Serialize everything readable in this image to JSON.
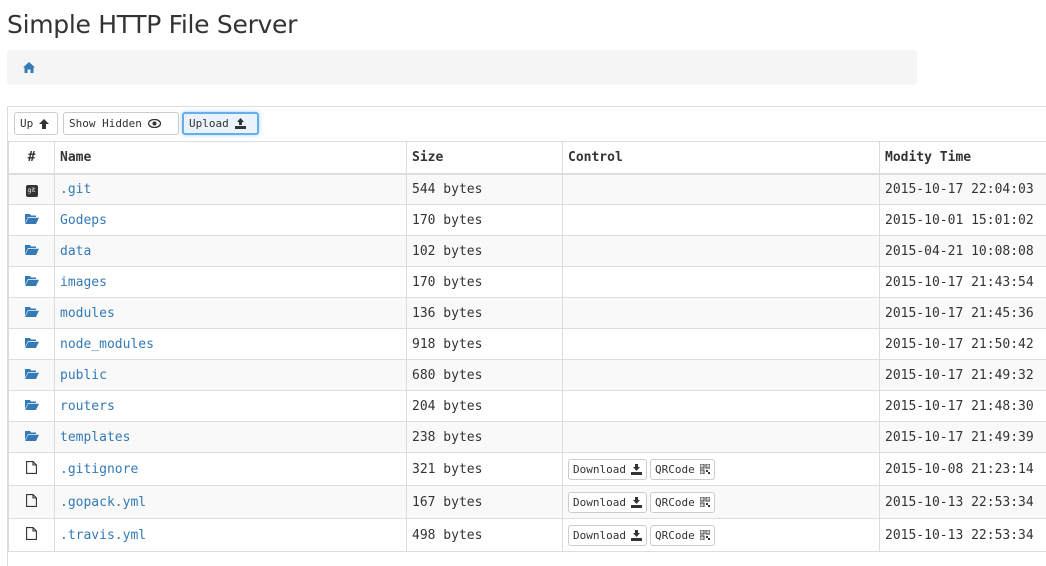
{
  "page": {
    "title": "Simple HTTP File Server"
  },
  "toolbar": {
    "up": "Up",
    "show_hidden": "Show Hidden",
    "upload": "Upload"
  },
  "table": {
    "headers": {
      "index": "#",
      "name": "Name",
      "size": "Size",
      "control": "Control",
      "mtime": "Modity Time"
    },
    "rows": [
      {
        "type": "git",
        "name": ".git",
        "size": "544 bytes",
        "mtime": "2015-10-17 22:04:03"
      },
      {
        "type": "folder",
        "name": "Godeps",
        "size": "170 bytes",
        "mtime": "2015-10-01 15:01:02"
      },
      {
        "type": "folder",
        "name": "data",
        "size": "102 bytes",
        "mtime": "2015-04-21 10:08:08"
      },
      {
        "type": "folder",
        "name": "images",
        "size": "170 bytes",
        "mtime": "2015-10-17 21:43:54"
      },
      {
        "type": "folder",
        "name": "modules",
        "size": "136 bytes",
        "mtime": "2015-10-17 21:45:36"
      },
      {
        "type": "folder",
        "name": "node_modules",
        "size": "918 bytes",
        "mtime": "2015-10-17 21:50:42"
      },
      {
        "type": "folder",
        "name": "public",
        "size": "680 bytes",
        "mtime": "2015-10-17 21:49:32"
      },
      {
        "type": "folder",
        "name": "routers",
        "size": "204 bytes",
        "mtime": "2015-10-17 21:48:30"
      },
      {
        "type": "folder",
        "name": "templates",
        "size": "238 bytes",
        "mtime": "2015-10-17 21:49:39"
      },
      {
        "type": "file",
        "name": ".gitignore",
        "size": "321 bytes",
        "mtime": "2015-10-08 21:23:14",
        "download": "Download",
        "qrcode": "QRCode"
      },
      {
        "type": "file",
        "name": ".gopack.yml",
        "size": "167 bytes",
        "mtime": "2015-10-13 22:53:34",
        "download": "Download",
        "qrcode": "QRCode"
      },
      {
        "type": "file",
        "name": ".travis.yml",
        "size": "498 bytes",
        "mtime": "2015-10-13 22:53:34",
        "download": "Download",
        "qrcode": "QRCode"
      }
    ]
  },
  "icons": {
    "home": "home-icon",
    "git": "git-icon",
    "folder": "folder-open-icon",
    "file": "file-icon",
    "up": "arrow-up-icon",
    "eye": "eye-icon",
    "upload": "upload-icon",
    "download": "download-icon",
    "qrcode": "qrcode-icon"
  },
  "colors": {
    "link": "#337ab7",
    "active_border": "#66afe9"
  }
}
